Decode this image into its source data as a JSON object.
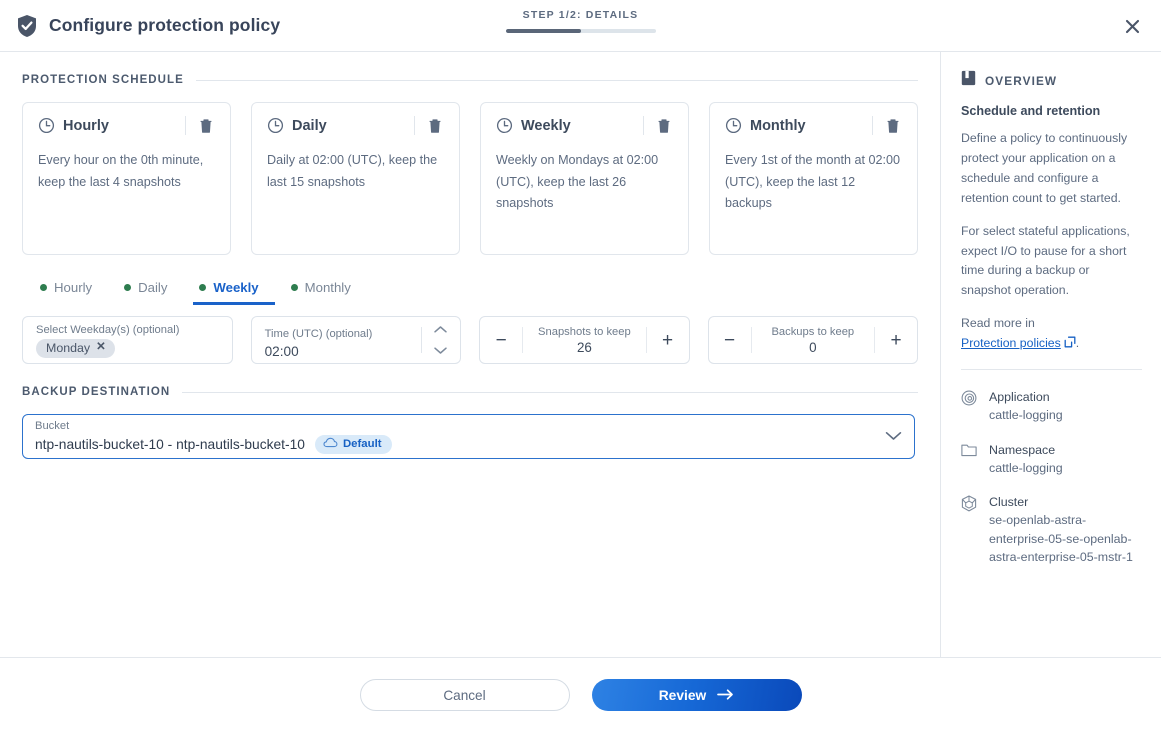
{
  "header": {
    "icon": "shield-check-icon",
    "title": "Configure protection policy",
    "step_label": "STEP 1/2: DETAILS",
    "progress_percent": 50,
    "close_icon": "close-icon"
  },
  "sections": {
    "schedule_heading": "PROTECTION SCHEDULE",
    "destination_heading": "BACKUP DESTINATION"
  },
  "schedule_cards": [
    {
      "icon": "clock-icon",
      "title": "Hourly",
      "description": "Every hour on the 0th minute, keep the last 4 snapshots",
      "delete_icon": "trash-icon"
    },
    {
      "icon": "clock-icon",
      "title": "Daily",
      "description": "Daily at 02:00 (UTC), keep the last 15 snapshots",
      "delete_icon": "trash-icon"
    },
    {
      "icon": "clock-icon",
      "title": "Weekly",
      "description": "Weekly on Mondays at 02:00 (UTC), keep the last 26 snapshots",
      "delete_icon": "trash-icon"
    },
    {
      "icon": "clock-icon",
      "title": "Monthly",
      "description": "Every 1st of the month at 02:00 (UTC), keep the last 12 backups",
      "delete_icon": "trash-icon"
    }
  ],
  "tabs": [
    {
      "label": "Hourly",
      "active": false,
      "dot_color": "#2e7d4f"
    },
    {
      "label": "Daily",
      "active": false,
      "dot_color": "#2e7d4f"
    },
    {
      "label": "Weekly",
      "active": true,
      "dot_color": "#2e7d4f"
    },
    {
      "label": "Monthly",
      "active": false,
      "dot_color": "#2e7d4f"
    }
  ],
  "form": {
    "weekday": {
      "label": "Select Weekday(s) (optional)",
      "chips": [
        "Monday"
      ],
      "chip_remove_icon": "close-icon"
    },
    "time": {
      "label": "Time (UTC) (optional)",
      "value": "02:00",
      "up_icon": "chevron-up-icon",
      "down_icon": "chevron-down-icon"
    },
    "snapshots_to_keep": {
      "label": "Snapshots to keep",
      "value": "26",
      "minus_label": "−",
      "plus_label": "+"
    },
    "backups_to_keep": {
      "label": "Backups to keep",
      "value": "0",
      "minus_label": "−",
      "plus_label": "+"
    }
  },
  "bucket": {
    "label": "Bucket",
    "value": "ntp-nautils-bucket-10 - ntp-nautils-bucket-10",
    "badge_label": "Default",
    "badge_icon": "cloud-icon",
    "chevron_icon": "chevron-down-icon"
  },
  "overview": {
    "icon": "book-icon",
    "heading": "OVERVIEW",
    "subheading": "Schedule and retention",
    "paragraph1": "Define a policy to continuously protect your application on a schedule and configure a retention count to get started.",
    "paragraph2": "For select stateful applications, expect I/O to pause for a short time during a backup or snapshot operation.",
    "read_more_prefix": "Read more in",
    "link_label": "Protection policies",
    "link_icon": "external-link-icon",
    "link_suffix": ".",
    "meta": [
      {
        "icon": "application-icon",
        "label": "Application",
        "value": "cattle-logging"
      },
      {
        "icon": "folder-icon",
        "label": "Namespace",
        "value": "cattle-logging"
      },
      {
        "icon": "cluster-icon",
        "label": "Cluster",
        "value": "se-openlab-astra-enterprise-05-se-openlab-astra-enterprise-05-mstr-1"
      }
    ]
  },
  "footer": {
    "cancel_label": "Cancel",
    "review_label": "Review",
    "review_icon": "arrow-right-icon"
  },
  "colors": {
    "accent_blue": "#1761c4",
    "active_tab": "#1a62c9",
    "dot_green": "#2e7d4f",
    "text_dark": "#3d4a5c",
    "text_muted": "#5d6b80",
    "border": "#e1e6ec",
    "badge_bg": "#d9eaf9"
  }
}
